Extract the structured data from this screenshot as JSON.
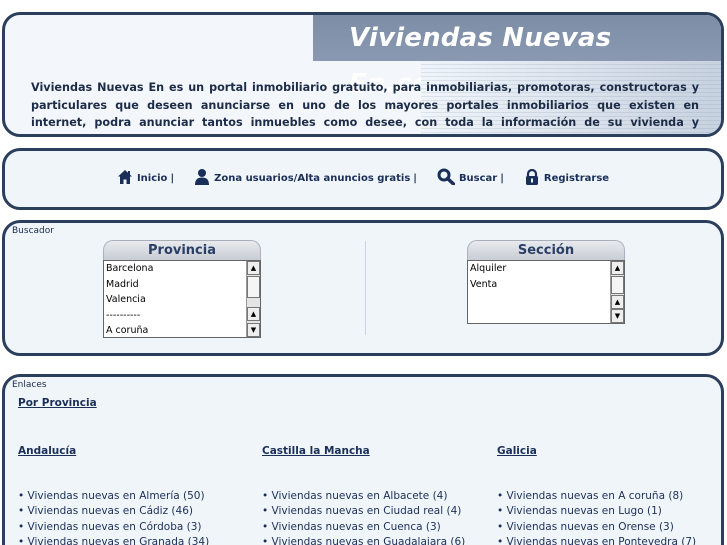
{
  "header": {
    "site_title": "Viviendas Nuevas En.com",
    "description": "Viviendas Nuevas En es un portal inmobiliario gratuito, para inmobiliarias, promotoras, constructoras y particulares que deseen anunciarse en uno de los mayores portales inmobiliarios que existen en internet, podra anunciar tantos inmuebles como desee, con toda la información de su vivienda y totalmente gratuito para darle un gran servicio sin coste alguno."
  },
  "nav": {
    "items": [
      {
        "label": "Inicio",
        "sep": "|",
        "icon": "home-icon"
      },
      {
        "label": "Zona usuarios/Alta anuncios gratis",
        "sep": "|",
        "icon": "user-icon"
      },
      {
        "label": "Buscar",
        "sep": "|",
        "icon": "search-icon"
      },
      {
        "label": "Registrarse",
        "sep": "",
        "icon": "lock-icon"
      }
    ]
  },
  "buscador": {
    "label": "Buscador",
    "provincia": {
      "title": "Provincia",
      "options": [
        "Barcelona",
        "Madrid",
        "Valencia",
        "----------",
        "A coruña"
      ]
    },
    "seccion": {
      "title": "Sección",
      "options": [
        "Alquiler",
        "Venta"
      ]
    }
  },
  "enlaces": {
    "label": "Enlaces",
    "por_provincia": "Por Provincia",
    "columns": [
      {
        "heading": "Andalucía",
        "items": [
          "• Viviendas nuevas en Almería (50)",
          "• Viviendas nuevas en Cádiz (46)",
          "• Viviendas nuevas en Córdoba (3)",
          "• Viviendas nuevas en Granada (34)"
        ]
      },
      {
        "heading": "Castilla la Mancha",
        "items": [
          "• Viviendas nuevas en Albacete (4)",
          "• Viviendas nuevas en Ciudad real (4)",
          "• Viviendas nuevas en Cuenca (3)",
          "• Viviendas nuevas en Guadalajara (6)"
        ]
      },
      {
        "heading": "Galicia",
        "items": [
          "• Viviendas nuevas en A coruña (8)",
          "• Viviendas nuevas en Lugo (1)",
          "• Viviendas nuevas en Orense (3)",
          "• Viviendas nuevas en Pontevedra (7)"
        ]
      }
    ]
  }
}
